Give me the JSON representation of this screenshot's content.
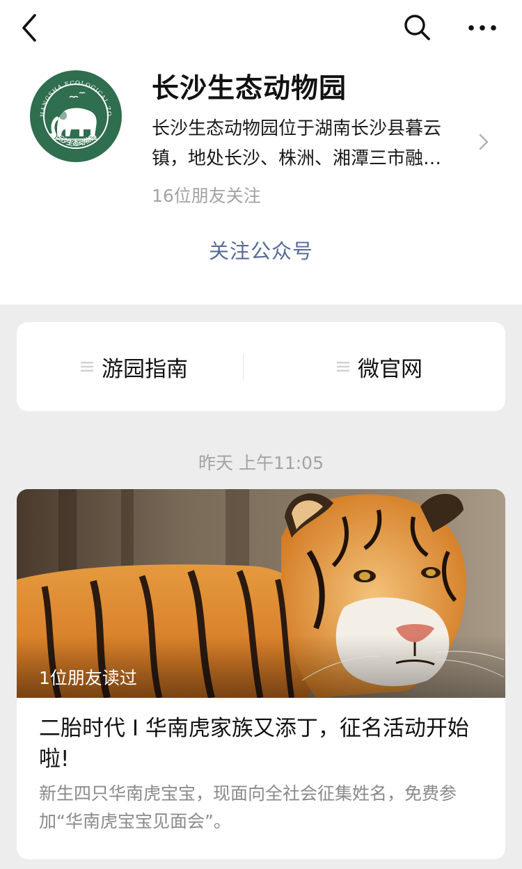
{
  "nav": {
    "back_icon": "chevron-left-icon",
    "search_icon": "search-icon",
    "more_icon": "ellipsis-icon"
  },
  "account": {
    "name": "长沙生态动物园",
    "description_line1": "长沙生态动物园位于湖南长沙县暮云",
    "description_line2": "镇，地处长沙、株洲、湘潭三市融…",
    "followers": "16位朋友关注",
    "follow_label": "关注公众号",
    "logo_text": "CHANGSHA ECOLOGICAL ZOO",
    "logo_subtext": "长沙生态动物园",
    "logo_color": "#2f6e4e"
  },
  "menu": {
    "items": [
      {
        "label": "游园指南"
      },
      {
        "label": "微官网"
      }
    ]
  },
  "feed": {
    "timestamp": "昨天 上午11:05",
    "article": {
      "friends_read": "1位朋友读过",
      "title": "二胎时代 I 华南虎家族又添丁，征名活动开始啦!",
      "digest": "新生四只华南虎宝宝，现面向全社会征集姓名，免费参加“华南虎宝宝见面会”。"
    }
  },
  "colors": {
    "link": "#576b95",
    "page_bg": "#ededed",
    "muted": "#a3a3a3"
  }
}
